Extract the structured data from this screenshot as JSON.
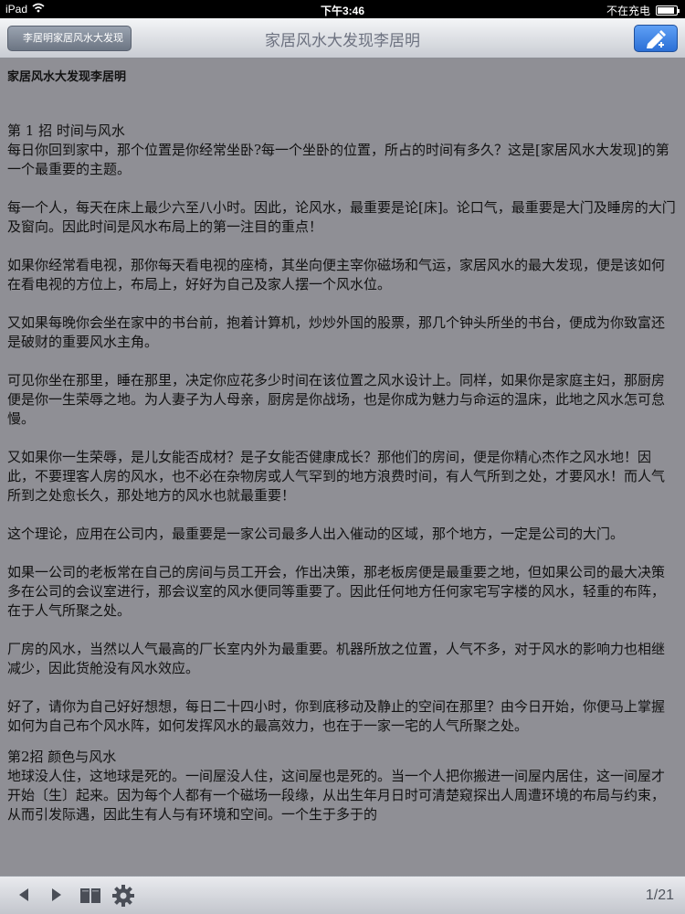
{
  "status_bar": {
    "device": "iPad",
    "time": "下午3:46",
    "charging": "不在充电",
    "battery_level": 0.9
  },
  "nav_bar": {
    "back_label": "李居明家居风水大发现",
    "title": "家居风水大发现李居明",
    "action_icon": "pencil-icon"
  },
  "content": {
    "doc_title": "家居风水大发现李居明",
    "chapter1": "第 1 招 时间与风水",
    "paragraphs": [
      "每日你回到家中，那个位置是你经常坐卧?每一个坐卧的位置，所占的时间有多久？这是[家居风水大发现]的第一个最重要的主题。",
      "每一个人，每天在床上最少六至八小时。因此，论风水，最重要是论[床]。论口气，最重要是大门及睡房的大门及窗向。因此时间是风水布局上的第一注目的重点！",
      "如果你经常看电视，那你每天看电视的座椅，其坐向便主宰你磁场和气运，家居风水的最大发现，便是该如何在看电视的方位上，布局上，好好为自己及家人摆一个风水位。",
      "又如果每晚你会坐在家中的书台前，抱着计算机，炒炒外国的股票，那几个钟头所坐的书台，便成为你致富还是破财的重要风水主角。",
      "可见你坐在那里，睡在那里，决定你应花多少时间在该位置之风水设计上。同样，如果你是家庭主妇，那厨房便是你一生荣辱之地。为人妻子为人母亲，厨房是你战场，也是你成为魅力与命运的温床，此地之风水怎可怠慢。",
      "又如果你一生荣辱，是儿女能否成材？是子女能否健康成长？那他们的房间，便是你精心杰作之风水地！因此，不要理客人房的风水，也不必在杂物房或人气罕到的地方浪费时间，有人气所到之处，才要风水！而人气所到之处愈长久，那处地方的风水也就最重要！",
      "这个理论，应用在公司内，最重要是一家公司最多人出入催动的区域，那个地方，一定是公司的大门。",
      "如果一公司的老板常在自己的房间与员工开会，作出决策，那老板房便是最重要之地，但如果公司的最大决策多在公司的会议室进行，那会议室的风水便同等重要了。因此任何地方任何家宅写字楼的风水，轻重的布阵，在于人气所聚之处。",
      "厂房的风水，当然以人气最高的厂长室内外为最重要。机器所放之位置，人气不多，对于风水的影响力也相继减少，因此货舱没有风水效应。",
      "好了，请你为自己好好想想，每日二十四小时，你到底移动及静止的空间在那里？由今日开始，你便马上掌握如何为自己布个风水阵，如何发挥风水的最高效力，也在于一家一宅的人气所聚之处。"
    ],
    "chapter2": "第2招 颜色与风水",
    "chapter2_para": "地球没人住，这地球是死的。一间屋没人住，这间屋也是死的。当一个人把你搬进一间屋内居住，这一间屋才开始〔生〕起来。因为每个人都有一个磁场一段缘，从出生年月日时可清楚窥探出人周遭环境的布局与约束，从而引发际遇，因此生有人与有环境和空间。一个生于多于的"
  },
  "toolbar": {
    "prev_icon": "prev-icon",
    "next_icon": "next-icon",
    "library_icon": "book-icon",
    "settings_icon": "gear-icon",
    "page_indicator": "1/21"
  }
}
